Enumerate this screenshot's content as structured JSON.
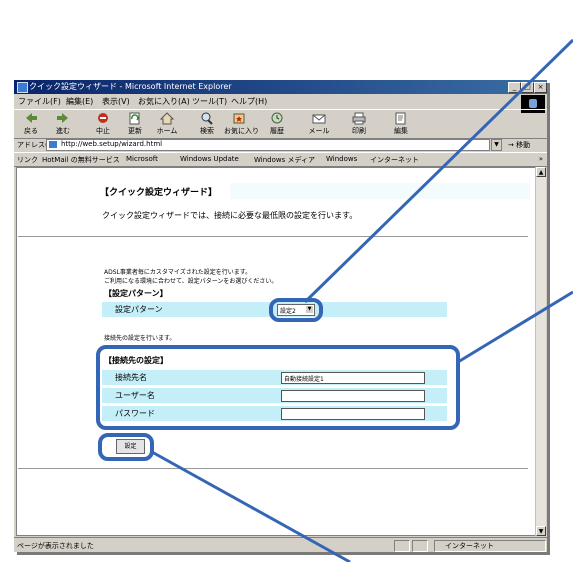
{
  "window": {
    "title": "クイック設定ウィザード - Microsoft Internet Explorer",
    "controls": {
      "minimize": "_",
      "maximize": "□",
      "close": "×"
    }
  },
  "menu": [
    "ファイル(F)",
    "編集(E)",
    "表示(V)",
    "お気に入り(A)",
    "ツール(T)",
    "ヘルプ(H)"
  ],
  "toolbar": [
    {
      "label": "戻る",
      "icon": "back-arrow-icon"
    },
    {
      "label": "進む",
      "icon": "forward-arrow-icon"
    },
    {
      "label": "中止",
      "icon": "stop-icon"
    },
    {
      "label": "更新",
      "icon": "refresh-icon"
    },
    {
      "label": "ホーム",
      "icon": "home-icon"
    },
    {
      "label": "検索",
      "icon": "search-icon"
    },
    {
      "label": "お気に入り",
      "icon": "favorites-icon"
    },
    {
      "label": "履歴",
      "icon": "history-icon"
    },
    {
      "label": "メール",
      "icon": "mail-icon"
    },
    {
      "label": "印刷",
      "icon": "print-icon"
    },
    {
      "label": "編集",
      "icon": "edit-icon"
    }
  ],
  "address": {
    "label": "アドレス(D)",
    "url": "http://web.setup/wizard.html",
    "go": "移動",
    "dropdown": "▼"
  },
  "links": {
    "label": "リンク",
    "items": [
      "HotMail の無料サービス",
      "Microsoft",
      "Windows Update",
      "Windows メディア",
      "Windows",
      "インターネット"
    ],
    "chevron": "»"
  },
  "page": {
    "title": "【クイック設定ウィザード】",
    "description": "クイック設定ウィザードでは、接続に必要な最低限の設定を行います。",
    "pattern_note_1": "ADSL事業者毎にカスタマイズされた設定を行います。",
    "pattern_note_2": "ご利用になる環境に合わせて、設定パターンをお選びください。",
    "pattern_heading": "【設定パターン】",
    "pattern_label": "設定パターン",
    "pattern_value": "設定2",
    "conn_note": "接続先の設定を行います。",
    "conn_heading": "【接続先の設定】",
    "conn_fields": [
      {
        "label": "接続先名",
        "value": "自動接続設定1"
      },
      {
        "label": "ユーザー名",
        "value": ""
      },
      {
        "label": "パスワード",
        "value": ""
      }
    ],
    "submit_label": "設定"
  },
  "status": {
    "text": "ページが表示されました",
    "zone": "インターネット"
  },
  "colors": {
    "callout": "#3566b6",
    "row_bg": "#c4eef8",
    "title_blue": "#0a246a"
  }
}
